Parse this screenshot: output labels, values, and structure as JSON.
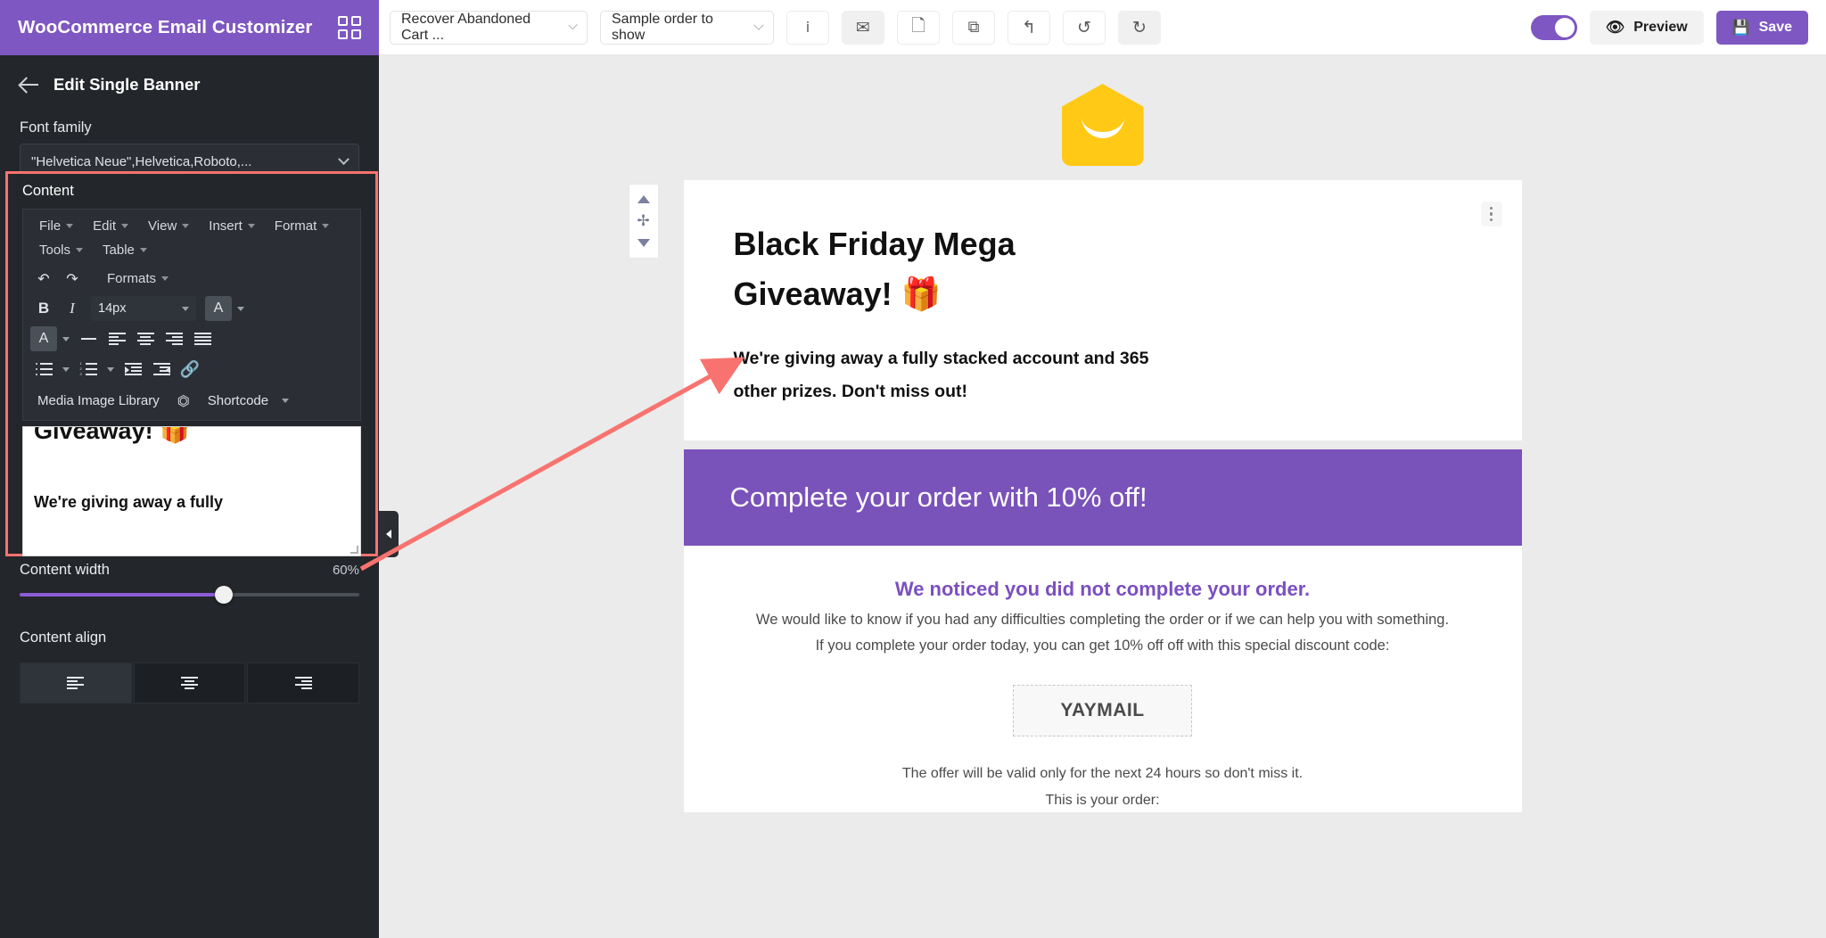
{
  "sidebar": {
    "app_title": "WooCommerce Email Customizer",
    "grid_icon": "grid-icon",
    "back_label": "Edit Single Banner",
    "font_family_label": "Font family",
    "font_family_value": "\"Helvetica Neue\",Helvetica,Roboto,...",
    "content_label": "Content",
    "editor": {
      "menus": [
        "File",
        "Edit",
        "View",
        "Insert",
        "Format",
        "Tools",
        "Table"
      ],
      "formats_label": "Formats",
      "undo_icon": "undo-icon",
      "redo_icon": "redo-icon",
      "bold_label": "B",
      "italic_label": "I",
      "font_size_value": "14px",
      "text_color_icon": "text-color-icon",
      "background_color_icon": "background-color-icon",
      "horizontal_rule_icon": "horizontal-rule-icon",
      "align_left_icon": "align-left-icon",
      "align_center_icon": "align-center-icon",
      "align_right_icon": "align-right-icon",
      "align_justify_icon": "align-justify-icon",
      "bullet_list_icon": "bullet-list-icon",
      "numbered_list_icon": "numbered-list-icon",
      "indent_increase_icon": "indent-increase-icon",
      "indent_decrease_icon": "indent-decrease-icon",
      "link_icon": "link-icon",
      "media_library_label": "Media Image Library",
      "fullscreen_icon": "fullscreen-icon",
      "shortcode_label": "Shortcode",
      "body_heading_clipped": "Giveaway! 🎁",
      "body_paragraph_clipped": "We're giving away a fully"
    },
    "content_width_label": "Content width",
    "content_width_value": "60%",
    "content_width_percent": 60,
    "content_align_label": "Content align",
    "content_align_options": [
      "align-left",
      "align-center",
      "align-right"
    ],
    "content_align_selected": 0,
    "collapse_handle_icon": "chevron-right-icon"
  },
  "topbar": {
    "email_template_select": "Recover Abandoned Cart ...",
    "sample_order_select": "Sample order to show",
    "icons": [
      {
        "name": "info-icon",
        "glyph": "i",
        "shaded": false
      },
      {
        "name": "email-icon",
        "glyph": "✉",
        "shaded": true
      },
      {
        "name": "page-icon",
        "glyph": "🗋",
        "shaded": false
      },
      {
        "name": "duplicate-icon",
        "glyph": "⧉",
        "shaded": false
      },
      {
        "name": "reply-icon",
        "glyph": "↰",
        "shaded": false
      },
      {
        "name": "undo-history-icon",
        "glyph": "↺",
        "shaded": false
      },
      {
        "name": "redo-history-icon",
        "glyph": "↻",
        "shaded": true
      }
    ],
    "toggle_on": true,
    "preview_label": "Preview",
    "preview_icon": "eye-icon",
    "save_label": "Save",
    "save_icon": "floppy-disk-icon",
    "accent_color": "#7e57c2"
  },
  "email": {
    "logo_icon": "yaymail-envelope-logo",
    "logo_color": "#ffc915",
    "block_menu_icon": "three-dots-vertical-icon",
    "move_up_icon": "move-up-icon",
    "move_handle_icon": "move-handle-icon",
    "move_down_icon": "move-down-icon",
    "hero_heading": "Black Friday Mega Giveaway! 🎁",
    "hero_paragraph": "We're giving away a fully stacked account and 365 other prizes. Don't miss out!",
    "banner_text": "Complete your order with 10% off!",
    "banner_color": "#7952ba",
    "body_heading": "We noticed you did not complete your order.",
    "body_heading_color": "#7b4fc0",
    "body_line_1": "We would like to know if you had any difficulties completing the order or if we can help you with something.",
    "body_line_2": "If you complete your order today, you can get 10% off off with this special discount code:",
    "coupon_code": "YAYMAIL",
    "footer_line_1": "The offer will be valid only for the next 24 hours so don't miss it.",
    "footer_line_2": "This is your order:"
  }
}
